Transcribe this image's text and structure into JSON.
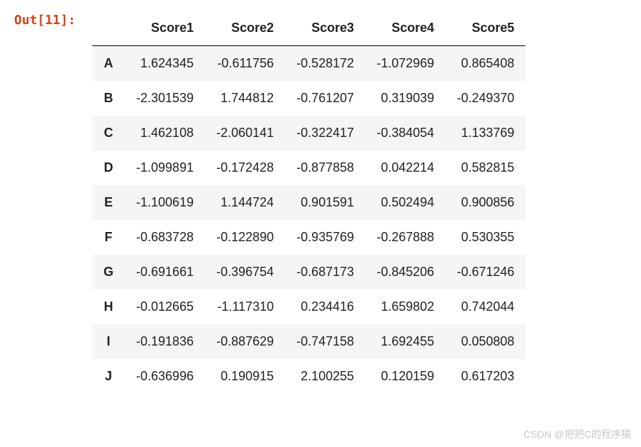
{
  "prompt": "Out[11]:",
  "chart_data": {
    "type": "table",
    "columns": [
      "Score1",
      "Score2",
      "Score3",
      "Score4",
      "Score5"
    ],
    "index": [
      "A",
      "B",
      "C",
      "D",
      "E",
      "F",
      "G",
      "H",
      "I",
      "J"
    ],
    "data": [
      [
        "1.624345",
        "-0.611756",
        "-0.528172",
        "-1.072969",
        "0.865408"
      ],
      [
        "-2.301539",
        "1.744812",
        "-0.761207",
        "0.319039",
        "-0.249370"
      ],
      [
        "1.462108",
        "-2.060141",
        "-0.322417",
        "-0.384054",
        "1.133769"
      ],
      [
        "-1.099891",
        "-0.172428",
        "-0.877858",
        "0.042214",
        "0.582815"
      ],
      [
        "-1.100619",
        "1.144724",
        "0.901591",
        "0.502494",
        "0.900856"
      ],
      [
        "-0.683728",
        "-0.122890",
        "-0.935769",
        "-0.267888",
        "0.530355"
      ],
      [
        "-0.691661",
        "-0.396754",
        "-0.687173",
        "-0.845206",
        "-0.671246"
      ],
      [
        "-0.012665",
        "-1.117310",
        "0.234416",
        "1.659802",
        "0.742044"
      ],
      [
        "-0.191836",
        "-0.887629",
        "-0.747158",
        "1.692455",
        "0.050808"
      ],
      [
        "-0.636996",
        "0.190915",
        "2.100255",
        "0.120159",
        "0.617203"
      ]
    ]
  },
  "watermark": "CSDN @把把C的程序猿"
}
